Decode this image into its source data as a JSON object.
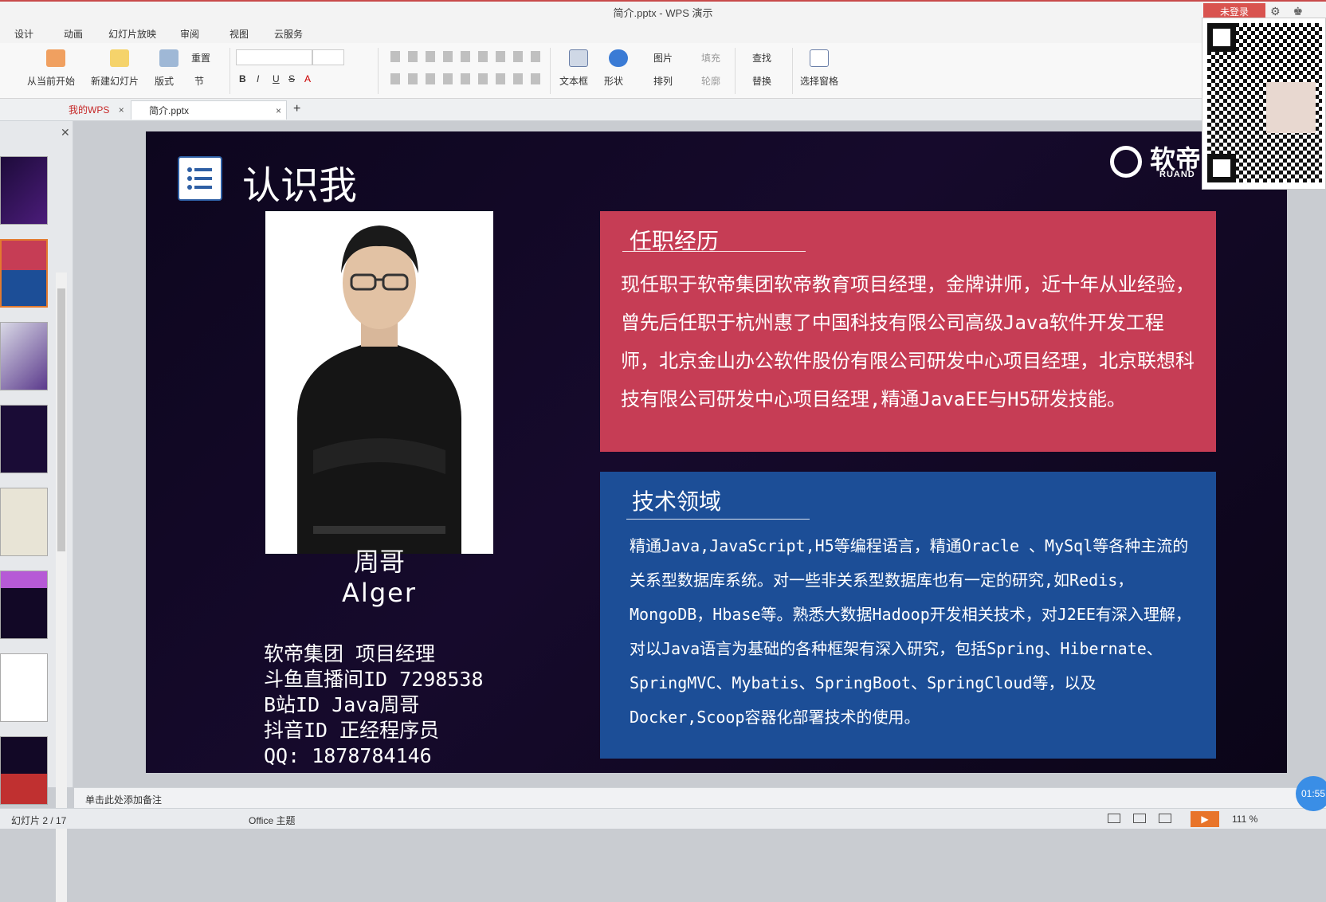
{
  "titlebar": {
    "title": "简介.pptx - WPS 演示",
    "login": "未登录"
  },
  "menu": [
    "设计",
    "动画",
    "幻灯片放映",
    "审阅",
    "视图",
    "云服务"
  ],
  "ribbon": {
    "from_current": "从当前开始",
    "new_slide": "新建幻灯片",
    "layout": "版式",
    "reset": "重置",
    "section": "节",
    "picture": "图片",
    "fill": "填充",
    "textbox": "文本框",
    "shape": "形状",
    "arrange": "排列",
    "outline": "轮廓",
    "find": "查找",
    "replace": "替换",
    "select_pane": "选择窗格",
    "bold": "B",
    "italic": "I",
    "underline": "U",
    "strike": "S",
    "fontcolor": "A"
  },
  "tabs": {
    "home": "我的WPS",
    "doc": "简介.pptx",
    "close": "×",
    "add": "+"
  },
  "slide": {
    "title": "认识我",
    "logo_text": "软帝",
    "logo_sub": "RUAND",
    "name_cn": "周哥",
    "name_en": "Alger",
    "info": [
      "软帝集团  项目经理",
      "斗鱼直播间ID 7298538",
      "B站ID Java周哥",
      "抖音ID 正经程序员",
      "QQ: 1878784146"
    ],
    "card1_title": "任职经历",
    "card1_text": "现任职于软帝集团软帝教育项目经理，金牌讲师，近十年从业经验，曾先后任职于杭州惠了中国科技有限公司高级Java软件开发工程师，北京金山办公软件股份有限公司研发中心项目经理，北京联想科技有限公司研发中心项目经理,精通JavaEE与H5研发技能。",
    "card2_title": "技术领域",
    "card2_text": "精通Java,JavaScript,H5等编程语言，精通Oracle 、MySql等各种主流的关系型数据库系统。对一些非关系型数据库也有一定的研究,如Redis，MongoDB，Hbase等。熟悉大数据Hadoop开发相关技术，对J2EE有深入理解，对以Java语言为基础的各种框架有深入研究，包括Spring、Hibernate、SpringMVC、Mybatis、SpringBoot、SpringCloud等，以及Docker,Scoop容器化部署技术的使用。"
  },
  "notes": "单击此处添加备注",
  "status": {
    "slide": "幻灯片 2 / 17",
    "theme": "Office 主题",
    "zoom": "111 %"
  },
  "timer": "01:55",
  "colors": {
    "accent_red": "#c63d55",
    "accent_blue": "#1c4e97",
    "slide_bg": "#120826"
  }
}
